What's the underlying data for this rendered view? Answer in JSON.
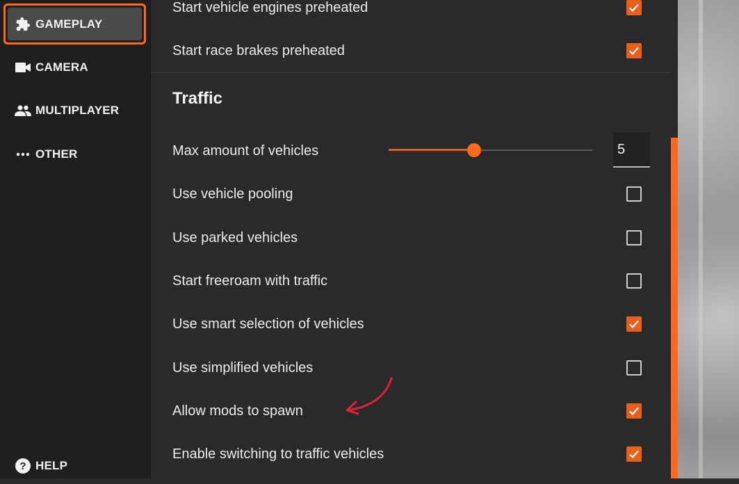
{
  "sidebar": {
    "items": [
      {
        "label": "GAMEPLAY",
        "icon": "puzzle-icon",
        "active": true
      },
      {
        "label": "CAMERA",
        "icon": "camera-icon",
        "active": false
      },
      {
        "label": "MULTIPLAYER",
        "icon": "people-icon",
        "active": false
      },
      {
        "label": "OTHER",
        "icon": "more-dots-icon",
        "active": false
      }
    ],
    "help_label": "HELP"
  },
  "settings": {
    "top_rows": [
      {
        "label": "Start vehicle engines preheated",
        "checked": true
      },
      {
        "label": "Start race brakes preheated",
        "checked": true
      }
    ],
    "traffic": {
      "title": "Traffic",
      "max_vehicles": {
        "label": "Max amount of vehicles",
        "value": "5",
        "slider_fraction": 0.42
      },
      "rows": [
        {
          "label": "Use vehicle pooling",
          "checked": false
        },
        {
          "label": "Use parked vehicles",
          "checked": false
        },
        {
          "label": "Start freeroam with traffic",
          "checked": false
        },
        {
          "label": "Use smart selection of vehicles",
          "checked": true
        },
        {
          "label": "Use simplified vehicles",
          "checked": false
        },
        {
          "label": "Allow mods to spawn",
          "checked": true
        },
        {
          "label": "Enable switching to traffic vehicles",
          "checked": true
        }
      ]
    }
  },
  "colors": {
    "accent": "#e8601c",
    "annotation_arrow": "#e0203a"
  }
}
